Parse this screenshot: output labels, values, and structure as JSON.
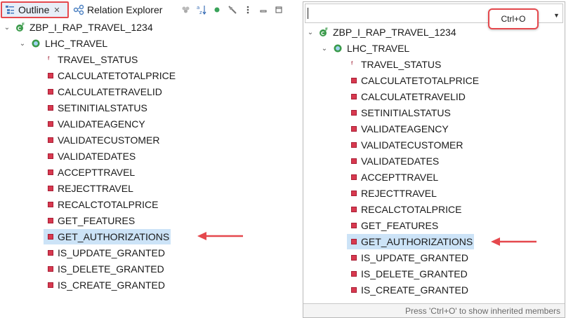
{
  "left": {
    "tabs": {
      "outline": "Outline",
      "relation_explorer": "Relation Explorer"
    },
    "toolbar_icons": [
      "link-icon",
      "sort-az-icon",
      "dot-icon",
      "filter-icon",
      "menu-icon",
      "minimize-icon",
      "maximize-icon"
    ],
    "tree": {
      "root": "ZBP_I_RAP_TRAVEL_1234",
      "class": "LHC_TRAVEL",
      "type_item": "TRAVEL_STATUS",
      "methods": [
        "CALCULATETOTALPRICE",
        "CALCULATETRAVELID",
        "SETINITIALSTATUS",
        "VALIDATEAGENCY",
        "VALIDATECUSTOMER",
        "VALIDATEDATES",
        "ACCEPTTRAVEL",
        "REJECTTRAVEL",
        "RECALCTOTALPRICE",
        "GET_FEATURES",
        "GET_AUTHORIZATIONS",
        "IS_UPDATE_GRANTED",
        "IS_DELETE_GRANTED",
        "IS_CREATE_GRANTED"
      ],
      "selected": "GET_AUTHORIZATIONS"
    }
  },
  "right": {
    "filter_value": "",
    "shortcut_badge": "Ctrl+O",
    "tree": {
      "root": "ZBP_I_RAP_TRAVEL_1234",
      "class": "LHC_TRAVEL",
      "type_item": "TRAVEL_STATUS",
      "methods": [
        "CALCULATETOTALPRICE",
        "CALCULATETRAVELID",
        "SETINITIALSTATUS",
        "VALIDATEAGENCY",
        "VALIDATECUSTOMER",
        "VALIDATEDATES",
        "ACCEPTTRAVEL",
        "REJECTTRAVEL",
        "RECALCTOTALPRICE",
        "GET_FEATURES",
        "GET_AUTHORIZATIONS",
        "IS_UPDATE_GRANTED",
        "IS_DELETE_GRANTED",
        "IS_CREATE_GRANTED"
      ],
      "selected": "GET_AUTHORIZATIONS"
    },
    "status_hint": "Press 'Ctrl+O' to show inherited members"
  },
  "colors": {
    "highlight_red": "#e5484d",
    "selection_blue": "#cce3f7",
    "method_icon": "#d8394f",
    "class_icon": "#3a9a4a"
  }
}
